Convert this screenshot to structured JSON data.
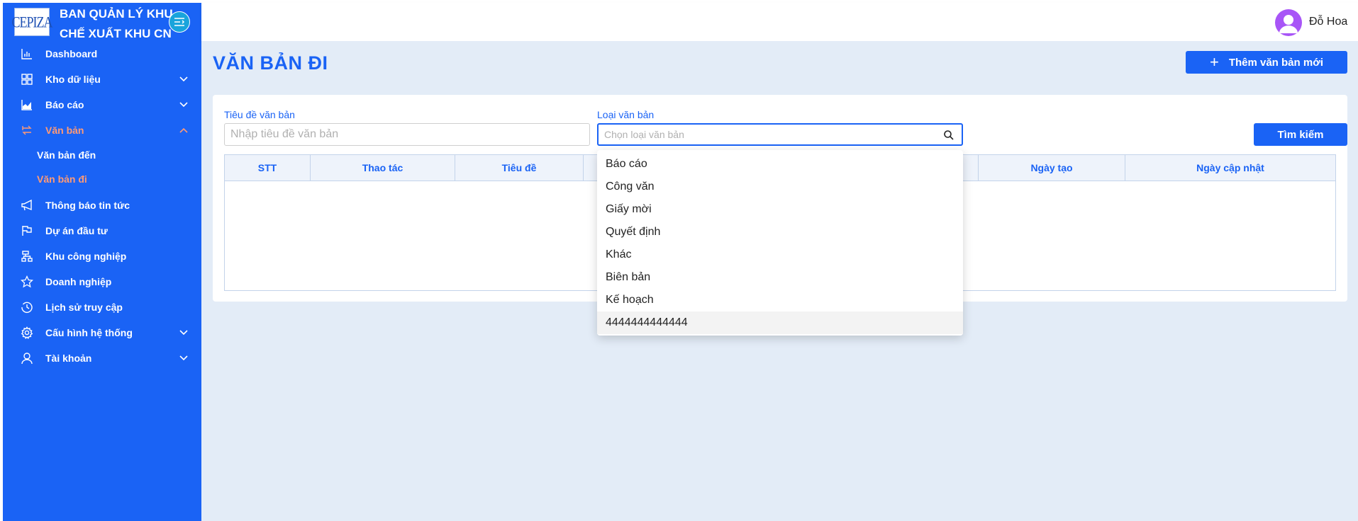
{
  "brand": {
    "logo_text": "CEPIZA",
    "title_line1": "BAN QUẢN LÝ KHU",
    "title_line2": "CHẾ XUẤT KHU CN"
  },
  "sidebar": {
    "items": [
      {
        "label": "Dashboard",
        "icon": "chart-icon"
      },
      {
        "label": "Kho dữ liệu",
        "icon": "grid-icon"
      },
      {
        "label": "Báo cáo",
        "icon": "area-chart-icon"
      },
      {
        "label": "Văn bản",
        "icon": "document-transfer-icon"
      },
      {
        "label": "Thông báo tin tức",
        "icon": "megaphone-icon"
      },
      {
        "label": "Dự án đầu tư",
        "icon": "flag-icon"
      },
      {
        "label": "Khu công nghiệp",
        "icon": "network-icon"
      },
      {
        "label": "Doanh nghiệp",
        "icon": "star-icon"
      },
      {
        "label": "Lịch sử truy cập",
        "icon": "history-icon"
      },
      {
        "label": "Cấu hình hệ thống",
        "icon": "gear-icon"
      },
      {
        "label": "Tài khoản",
        "icon": "user-icon"
      }
    ],
    "subitems": [
      {
        "label": "Văn bản đến"
      },
      {
        "label": "Văn bản đi"
      }
    ]
  },
  "topbar": {
    "username": "Đỗ Hoa"
  },
  "page": {
    "title": "VĂN BẢN ĐI",
    "add_button": "Thêm văn bản mới"
  },
  "filters": {
    "title_label": "Tiêu đề văn bản",
    "title_placeholder": "Nhập tiêu đề văn bản",
    "type_label": "Loại văn bản",
    "type_placeholder": "Chọn loại văn bản",
    "search_button": "Tìm kiếm"
  },
  "table": {
    "columns": [
      "STT",
      "Thao tác",
      "Tiêu đề",
      "",
      "",
      "Ngày tạo",
      "Ngày cập nhật"
    ]
  },
  "dropdown": {
    "options": [
      "Báo cáo",
      "Công văn",
      "Giấy mời",
      "Quyết định",
      "Khác",
      "Biên bản",
      "Kế hoạch",
      "4444444444444"
    ]
  },
  "colors": {
    "primary": "#1a63f5",
    "active": "#ff9a76",
    "background": "#e3ecf7"
  }
}
